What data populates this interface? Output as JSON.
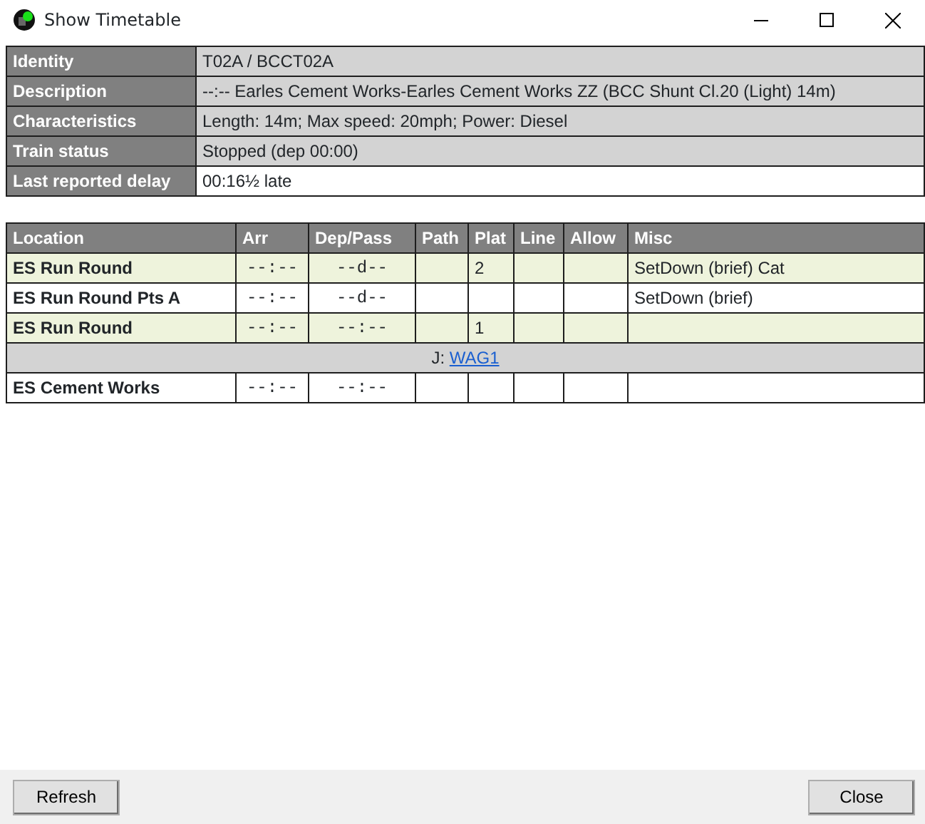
{
  "window": {
    "title": "Show Timetable"
  },
  "info": [
    {
      "label": "Identity",
      "value": "T02A / BCCT02A",
      "shaded": true
    },
    {
      "label": "Description",
      "value": "--:-- Earles Cement Works-Earles Cement Works ZZ (BCC Shunt Cl.20 (Light) 14m)",
      "shaded": true
    },
    {
      "label": "Characteristics",
      "value": "Length: 14m; Max speed: 20mph; Power: Diesel",
      "shaded": true
    },
    {
      "label": "Train status",
      "value": "Stopped (dep 00:00)",
      "shaded": true
    },
    {
      "label": "Last reported delay",
      "value": "00:16½ late",
      "shaded": false
    }
  ],
  "timetable": {
    "columns": [
      "Location",
      "Arr",
      "Dep/Pass",
      "Path",
      "Plat",
      "Line",
      "Allow",
      "Misc"
    ],
    "rows": [
      {
        "kind": "stop",
        "highlighted": true,
        "cells": [
          "ES Run Round",
          "--:--",
          "--d--",
          "",
          "2",
          "",
          "",
          "SetDown (brief) Cat"
        ]
      },
      {
        "kind": "stop",
        "highlighted": false,
        "cells": [
          "ES Run Round Pts A",
          "--:--",
          "--d--",
          "",
          "",
          "",
          "",
          "SetDown (brief)"
        ]
      },
      {
        "kind": "stop",
        "highlighted": true,
        "cells": [
          "ES Run Round",
          "--:--",
          "--:--",
          "",
          "1",
          "",
          "",
          ""
        ]
      },
      {
        "kind": "join",
        "prefix": "J:",
        "link": "WAG1"
      },
      {
        "kind": "stop",
        "highlighted": false,
        "cells": [
          "ES Cement Works",
          "--:--",
          "--:--",
          "",
          "",
          "",
          "",
          ""
        ]
      }
    ]
  },
  "buttons": [
    {
      "label": "Refresh"
    },
    {
      "label": "Close"
    }
  ]
}
